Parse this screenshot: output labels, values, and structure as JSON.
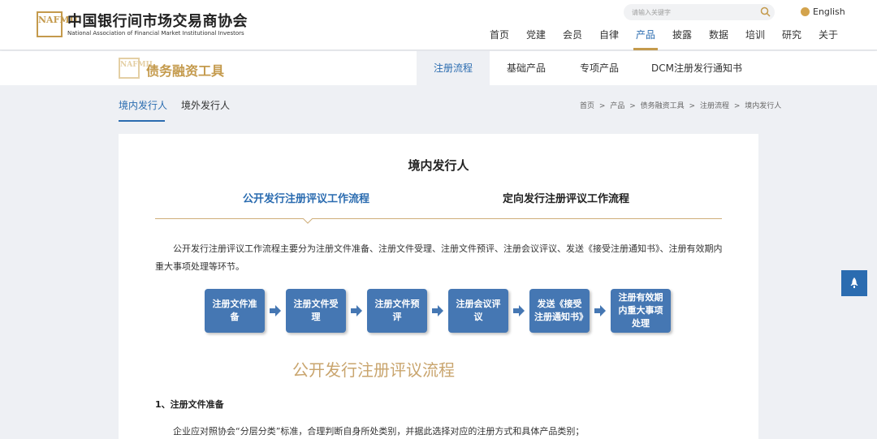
{
  "header": {
    "logo_cn": "中国银行间市场交易商协会",
    "logo_en": "National Association of Financial Market Institutional Investors",
    "logo_mark": "NAFMII",
    "search_placeholder": "请输入关键字",
    "language": "English",
    "nav": [
      "首页",
      "党建",
      "会员",
      "自律",
      "产品",
      "披露",
      "数据",
      "培训",
      "研究",
      "关于"
    ],
    "active_nav": "产品"
  },
  "subheader": {
    "title": "债务融资工具",
    "tabs": [
      "注册流程",
      "基础产品",
      "专项产品",
      "DCM注册发行通知书"
    ],
    "active_tab": "注册流程"
  },
  "issuer_tabs": [
    "境内发行人",
    "境外发行人"
  ],
  "breadcrumb": [
    "首页",
    ">",
    "产品",
    ">",
    "债务融资工具",
    ">",
    "注册流程",
    ">",
    "境内发行人"
  ],
  "content": {
    "title": "境内发行人",
    "flow_tabs": [
      "公开发行注册评议工作流程",
      "定向发行注册评议工作流程"
    ],
    "intro": "公开发行注册评议工作流程主要分为注册文件准备、注册文件受理、注册文件预评、注册会议评议、发送《接受注册通知书》、注册有效期内重大事项处理等环节。",
    "steps": [
      "注册文件准备",
      "注册文件受理",
      "注册文件预评",
      "注册会议评议",
      "发送《接受注册通知书》",
      "注册有效期内重大事项处理"
    ],
    "section_heading": "公开发行注册评议流程",
    "subsection": "1、注册文件准备",
    "paragraph": "企业应对照协会“分层分类”标准，合理判断自身所处类别，并据此选择对应的注册方式和具体产品类别；"
  },
  "colors": {
    "accent_blue": "#2b6cb0",
    "step_blue": "#4577b3",
    "gold": "#c49a4c"
  }
}
